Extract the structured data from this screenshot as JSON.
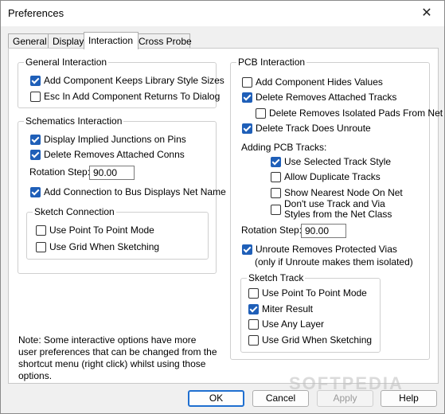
{
  "window": {
    "title": "Preferences",
    "close_glyph": "✕"
  },
  "tabs": [
    {
      "label": "General"
    },
    {
      "label": "Display"
    },
    {
      "label": "Interaction",
      "active": true
    },
    {
      "label": "Cross Probe"
    }
  ],
  "general_interaction": {
    "legend": "General Interaction",
    "items": [
      {
        "label": "Add Component Keeps Library Style Sizes",
        "checked": true
      },
      {
        "label": "Esc In Add Component Returns To Dialog",
        "checked": false
      }
    ]
  },
  "schematics_interaction": {
    "legend": "Schematics Interaction",
    "items": [
      {
        "label": "Display Implied Junctions on Pins",
        "checked": true
      },
      {
        "label": "Delete Removes Attached Conns",
        "checked": true
      }
    ],
    "rotation_label": "Rotation Step:",
    "rotation_value": "90.00",
    "bus_item": {
      "label": "Add Connection to Bus Displays Net Name",
      "checked": true
    },
    "sketch": {
      "legend": "Sketch Connection",
      "items": [
        {
          "label": "Use Point To Point Mode",
          "checked": false
        },
        {
          "label": "Use Grid When Sketching",
          "checked": false
        }
      ]
    }
  },
  "note": "Note:  Some interactive options have more user preferences that can be changed from the shortcut menu (right click) whilst using those options.",
  "pcb_interaction": {
    "legend": "PCB Interaction",
    "items": [
      {
        "label": "Add Component Hides Values",
        "checked": false
      },
      {
        "label": "Delete Removes Attached Tracks",
        "checked": true
      },
      {
        "label": "Delete Removes Isolated Pads From Net",
        "checked": false
      },
      {
        "label": "Delete Track Does Unroute",
        "checked": true
      }
    ],
    "adding_label": "Adding PCB Tracks:",
    "adding_items": [
      {
        "label": "Use Selected Track Style",
        "checked": true
      },
      {
        "label": "Allow Duplicate Tracks",
        "checked": false
      },
      {
        "label": "Show Nearest Node On Net",
        "checked": false
      },
      {
        "label": "Don't use Track and Via Styles from the Net Class",
        "checked": false
      }
    ],
    "rotation_label": "Rotation Step:",
    "rotation_value": "90.00",
    "unroute": {
      "label": "Unroute Removes Protected Vias",
      "checked": true
    },
    "unroute_note": "(only if Unroute makes them isolated)",
    "sketch": {
      "legend": "Sketch Track",
      "items": [
        {
          "label": "Use Point To Point Mode",
          "checked": false
        },
        {
          "label": "Miter Result",
          "checked": true
        },
        {
          "label": "Use Any Layer",
          "checked": false
        },
        {
          "label": "Use Grid When Sketching",
          "checked": false
        }
      ]
    }
  },
  "buttons": {
    "ok": "OK",
    "cancel": "Cancel",
    "apply": "Apply",
    "help": "Help"
  },
  "watermark": "SOFTPEDIA"
}
